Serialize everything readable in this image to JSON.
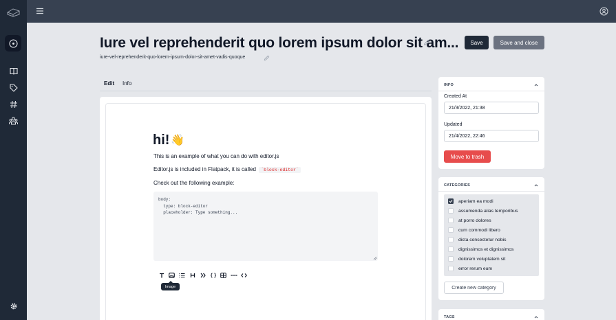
{
  "page": {
    "title": "Iure vel reprehenderit quo lorem ipsum dolor sit am...",
    "slug": "iure-vel-reprehenderit-quo-lorem-ipsum-dolor-sit-amet-vadis-quoque"
  },
  "actions": {
    "save_label": "Save",
    "save_close_label": "Save and close"
  },
  "tabs": [
    {
      "label": "Edit",
      "active": true
    },
    {
      "label": "Info",
      "active": false
    }
  ],
  "editor": {
    "heading": "hi!",
    "heading_emoji": "👋",
    "paragraph1": "This is an example of what you can do with editor.js",
    "paragraph2_prefix": "Editor.js is included in Flatpack, it is called",
    "paragraph2_code": "`block-editor`",
    "paragraph3": "Check out the following example:",
    "code_lines": [
      "body:",
      "  type: block-editor",
      "  placeholder: Type something..."
    ],
    "toolbar_tools": [
      "text-icon",
      "image-icon",
      "list-icon",
      "heading-icon",
      "quote-icon",
      "code-braces-icon",
      "table-icon",
      "delimiter-icon",
      "raw-html-icon"
    ],
    "tooltip": "Image"
  },
  "info_card": {
    "heading": "INFO",
    "created_label": "Created At",
    "created_value": "21/3/2022, 21:38",
    "updated_label": "Updated",
    "updated_value": "21/4/2022, 22:46",
    "trash_label": "Move to trash"
  },
  "categories_card": {
    "heading": "CATEGORIES",
    "items": [
      {
        "label": "aperiam ea modi",
        "checked": true
      },
      {
        "label": "assumenda alias temporibus",
        "checked": false
      },
      {
        "label": "at porro dolores",
        "checked": false
      },
      {
        "label": "cum commodi libero",
        "checked": false
      },
      {
        "label": "dicta consectetur nobis",
        "checked": false
      },
      {
        "label": "dignissimos et dignissimos",
        "checked": false
      },
      {
        "label": "dolorem voluptatem sit",
        "checked": false
      },
      {
        "label": "error rerum eum",
        "checked": false
      }
    ],
    "new_label": "Create new category"
  },
  "tags_card": {
    "heading": "TAGS"
  },
  "colors": {
    "sidebar": "#1f2937",
    "topbar": "#374151",
    "danger": "#e74c4c",
    "primary": "#1f2937",
    "secondary": "#6b7280"
  }
}
